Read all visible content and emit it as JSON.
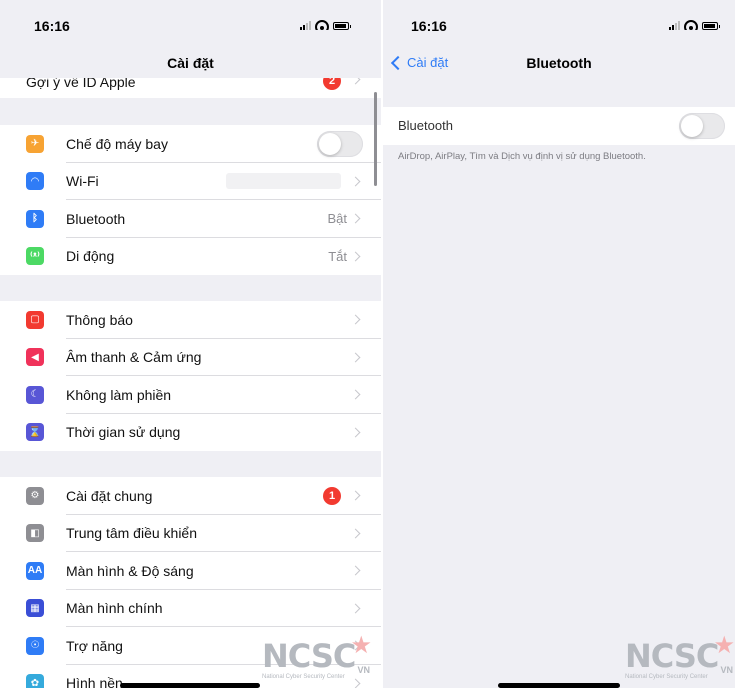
{
  "left": {
    "status_time": "16:16",
    "nav_title": "Cài đặt",
    "top_partial_label": "Gợi ý về ID Apple",
    "top_partial_badge": "2",
    "groups": [
      [
        {
          "label": "Chế độ máy bay",
          "icon": "airplane-icon",
          "color": "#f7a333",
          "accessory": "toggle"
        },
        {
          "label": "Wi-Fi",
          "icon": "wifi-icon",
          "color": "#2f7cf6",
          "accessory": "blurred-value"
        },
        {
          "label": "Bluetooth",
          "icon": "bluetooth-icon",
          "color": "#2f7cf6",
          "value": "Bật"
        },
        {
          "label": "Di động",
          "icon": "cellular-icon",
          "color": "#4cd964",
          "value": "Tắt"
        }
      ],
      [
        {
          "label": "Thông báo",
          "icon": "notifications-icon",
          "color": "#f23a30"
        },
        {
          "label": "Âm thanh & Cảm ứng",
          "icon": "sound-icon",
          "color": "#f0325a"
        },
        {
          "label": "Không làm phiền",
          "icon": "moon-icon",
          "color": "#5856d6"
        },
        {
          "label": "Thời gian sử dụng",
          "icon": "hourglass-icon",
          "color": "#5856d6"
        }
      ],
      [
        {
          "label": "Cài đặt chung",
          "icon": "gear-icon",
          "color": "#8e8e93",
          "badge": "1"
        },
        {
          "label": "Trung tâm điều khiển",
          "icon": "control-center-icon",
          "color": "#8e8e93"
        },
        {
          "label": "Màn hình & Độ sáng",
          "icon": "display-icon",
          "color": "#2f7cf6"
        },
        {
          "label": "Màn hình chính",
          "icon": "home-screen-icon",
          "color": "#3a4ed6"
        },
        {
          "label": "Trợ năng",
          "icon": "accessibility-icon",
          "color": "#2f7cf6"
        },
        {
          "label": "Hình nền",
          "icon": "wallpaper-icon",
          "color": "#35aadc"
        }
      ]
    ],
    "icon_glyphs": {
      "display-icon": "AA"
    }
  },
  "right": {
    "status_time": "16:16",
    "back_label": "Cài đặt",
    "nav_title": "Bluetooth",
    "row_label": "Bluetooth",
    "footer_text": "AirDrop, AirPlay, Tìm và Dịch vụ định vị sử dụng Bluetooth."
  },
  "watermark": {
    "text": "NCSC",
    "suffix": "VN",
    "subtitle": "National Cyber Security Center"
  }
}
